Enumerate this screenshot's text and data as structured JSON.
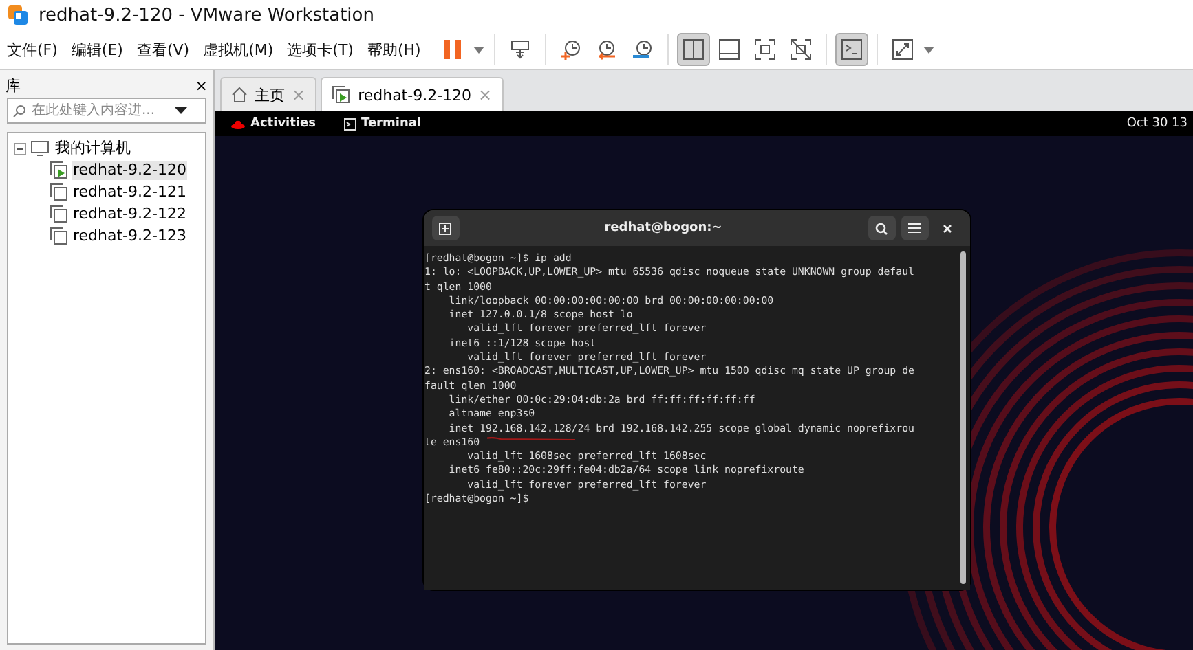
{
  "window": {
    "title": "redhat-9.2-120 - VMware Workstation"
  },
  "menu": [
    "文件(F)",
    "编辑(E)",
    "查看(V)",
    "虚拟机(M)",
    "选项卡(T)",
    "帮助(H)"
  ],
  "toolbar": [
    {
      "kind": "pause",
      "selected": false
    },
    {
      "kind": "caret",
      "selected": false
    },
    {
      "kind": "sep"
    },
    {
      "kind": "sendkeys",
      "selected": false
    },
    {
      "kind": "sep"
    },
    {
      "kind": "snapshot",
      "selected": false
    },
    {
      "kind": "revert",
      "selected": false
    },
    {
      "kind": "manager",
      "selected": false
    },
    {
      "kind": "sep"
    },
    {
      "kind": "library",
      "selected": true
    },
    {
      "kind": "thumbs",
      "selected": false
    },
    {
      "kind": "fullscreen",
      "selected": false
    },
    {
      "kind": "unity",
      "selected": false
    },
    {
      "kind": "sep"
    },
    {
      "kind": "console",
      "selected": true
    },
    {
      "kind": "sep"
    },
    {
      "kind": "stretch",
      "selected": false
    },
    {
      "kind": "caret",
      "selected": false
    }
  ],
  "library": {
    "title": "库",
    "close": "×",
    "search": {
      "placeholder": "在此处键入内容进..."
    },
    "tree": [
      {
        "label": "我的计算机",
        "expanded": true,
        "children": [
          {
            "label": "redhat-9.2-120",
            "selected": true,
            "running": true
          },
          {
            "label": "redhat-9.2-121",
            "selected": false,
            "running": false
          },
          {
            "label": "redhat-9.2-122",
            "selected": false,
            "running": false
          },
          {
            "label": "redhat-9.2-123",
            "selected": false,
            "running": false
          }
        ]
      }
    ]
  },
  "tabs": [
    {
      "label": "主页",
      "kind": "home",
      "selected": false,
      "close": "×"
    },
    {
      "label": "redhat-9.2-120",
      "kind": "vm",
      "selected": true,
      "close": "×"
    }
  ],
  "gnome_bar": {
    "activities": "Activities",
    "app": "Terminal",
    "clock": "Oct 30  13"
  },
  "terminal": {
    "title": "redhat@bogon:~",
    "lines": [
      "[redhat@bogon ~]$ ip add",
      "1: lo: <LOOPBACK,UP,LOWER_UP> mtu 65536 qdisc noqueue state UNKNOWN group defaul",
      "t qlen 1000",
      "    link/loopback 00:00:00:00:00:00 brd 00:00:00:00:00:00",
      "    inet 127.0.0.1/8 scope host lo",
      "       valid_lft forever preferred_lft forever",
      "    inet6 ::1/128 scope host",
      "       valid_lft forever preferred_lft forever",
      "2: ens160: <BROADCAST,MULTICAST,UP,LOWER_UP> mtu 1500 qdisc mq state UP group de",
      "fault qlen 1000",
      "    link/ether 00:0c:29:04:db:2a brd ff:ff:ff:ff:ff:ff",
      "    altname enp3s0",
      "    inet 192.168.142.128/24 brd 192.168.142.255 scope global dynamic noprefixrou",
      "te ens160",
      "       valid_lft 1608sec preferred_lft 1608sec",
      "    inet6 fe80::20c:29ff:fe04:db2a/64 scope link noprefixroute",
      "       valid_lft forever preferred_lft forever",
      "[redhat@bogon ~]$"
    ]
  }
}
